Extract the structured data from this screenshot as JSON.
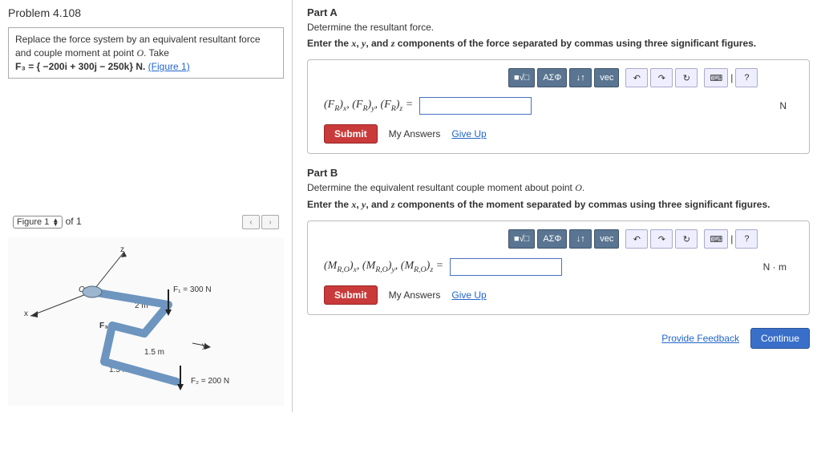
{
  "problem": {
    "number": "Problem 4.108",
    "statement1": "Replace the force system by an equivalent resultant force and couple moment at point ",
    "pointO": "O",
    "take": ". Take",
    "f3_eq": "F₃ = { −200i + 300j − 250k} N. ",
    "figlink": "(Figure 1)"
  },
  "figure": {
    "selector_label": "Figure 1",
    "of_text": "of 1",
    "prev": "‹",
    "next": "›",
    "labels": {
      "z": "z",
      "x": "x",
      "y": "y",
      "O": "O",
      "F1": "F₁ = 300 N",
      "F2": "F₂ = 200 N",
      "F3": "F₃",
      "d1": "2 m",
      "d2": "1.5 m",
      "d3": "1.5 m"
    }
  },
  "partA": {
    "heading": "Part A",
    "subtitle": "Determine the resultant force.",
    "prompt_pre": "Enter the ",
    "var_x": "x",
    "var_y": "y",
    "var_z": "z",
    "prompt_mid1": ", ",
    "prompt_mid2": ", and ",
    "prompt_post": " components of the force separated by commas using three significant figures.",
    "eq_label": "(F_R)_x, (F_R)_y, (F_R)_z =",
    "unit": "N",
    "submit": "Submit",
    "my_answers": "My Answers",
    "give_up": "Give Up"
  },
  "partB": {
    "heading": "Part B",
    "subtitle": "Determine the equivalent resultant couple moment about point O.",
    "prompt_pre": "Enter the ",
    "var_x": "x",
    "var_y": "y",
    "var_z": "z",
    "prompt_mid1": ", ",
    "prompt_mid2": ", and ",
    "prompt_post": " components of the moment separated by commas using three significant figures.",
    "eq_label": "(M_R,O)_x, (M_R,O)_y, (M_R,O)_z =",
    "unit": "N · m",
    "submit": "Submit",
    "my_answers": "My Answers",
    "give_up": "Give Up"
  },
  "toolbar": {
    "templates": "■√□",
    "greek": "ΑΣΦ",
    "subsup": "↓↑",
    "vec": "vec",
    "undo": "↶",
    "redo": "↷",
    "reset": "↻",
    "keyboard": "⌨",
    "sep": "|",
    "help": "?"
  },
  "footer": {
    "feedback": "Provide Feedback",
    "continue": "Continue"
  }
}
